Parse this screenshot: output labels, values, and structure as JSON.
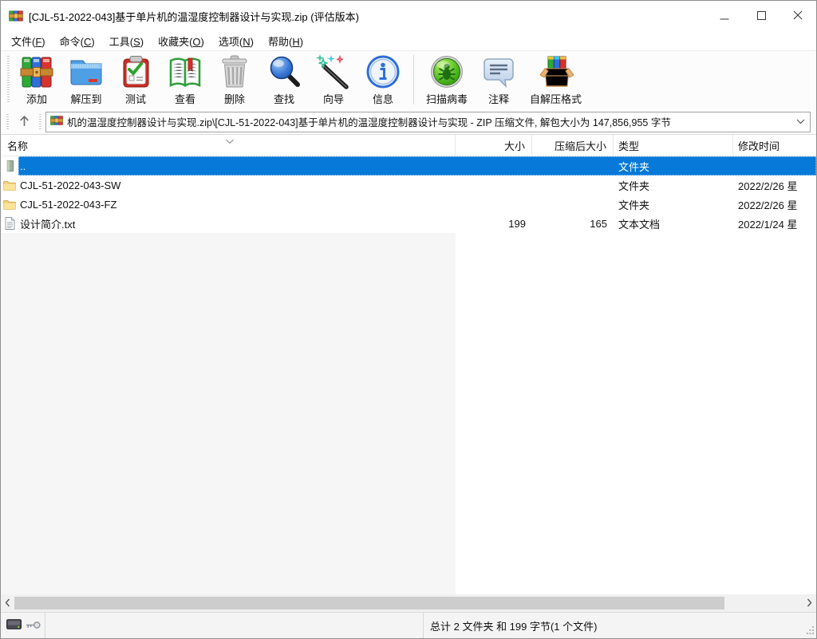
{
  "window": {
    "title": "[CJL-51-2022-043]基于单片机的温湿度控制器设计与实现.zip (评估版本)"
  },
  "menu": {
    "items": [
      {
        "pre": "文件(",
        "key": "F",
        "post": ")"
      },
      {
        "pre": "命令(",
        "key": "C",
        "post": ")"
      },
      {
        "pre": "工具(",
        "key": "S",
        "post": ")"
      },
      {
        "pre": "收藏夹(",
        "key": "O",
        "post": ")"
      },
      {
        "pre": "选项(",
        "key": "N",
        "post": ")"
      },
      {
        "pre": "帮助(",
        "key": "H",
        "post": ")"
      }
    ]
  },
  "toolbar": {
    "buttons": [
      {
        "label": "添加"
      },
      {
        "label": "解压到"
      },
      {
        "label": "测试"
      },
      {
        "label": "查看"
      },
      {
        "label": "删除"
      },
      {
        "label": "查找"
      },
      {
        "label": "向导"
      },
      {
        "label": "信息"
      },
      {
        "label": "扫描病毒"
      },
      {
        "label": "注释"
      },
      {
        "label": "自解压格式"
      }
    ]
  },
  "address": {
    "value": "机的温湿度控制器设计与实现.zip\\[CJL-51-2022-043]基于单片机的温湿度控制器设计与实现 - ZIP 压缩文件, 解包大小为 147,856,955 字节"
  },
  "columns": {
    "name": "名称",
    "size": "大小",
    "packed": "压缩后大小",
    "type": "类型",
    "modified": "修改时间"
  },
  "files": [
    {
      "name": "..",
      "size": "",
      "packed": "",
      "type": "文件夹",
      "modified": ""
    },
    {
      "name": "CJL-51-2022-043-SW",
      "size": "",
      "packed": "",
      "type": "文件夹",
      "modified": "2022/2/26 星"
    },
    {
      "name": "CJL-51-2022-043-FZ",
      "size": "",
      "packed": "",
      "type": "文件夹",
      "modified": "2022/2/26 星"
    },
    {
      "name": "设计简介.txt",
      "size": "199",
      "packed": "165",
      "type": "文本文档",
      "modified": "2022/1/24 星"
    }
  ],
  "statusbar": {
    "summary": "总计 2 文件夹 和 199 字节(1 个文件)"
  },
  "colors": {
    "accent": "#0779d8",
    "selection_text": "#ffffff",
    "empty_panel": "#f6f6f6"
  }
}
